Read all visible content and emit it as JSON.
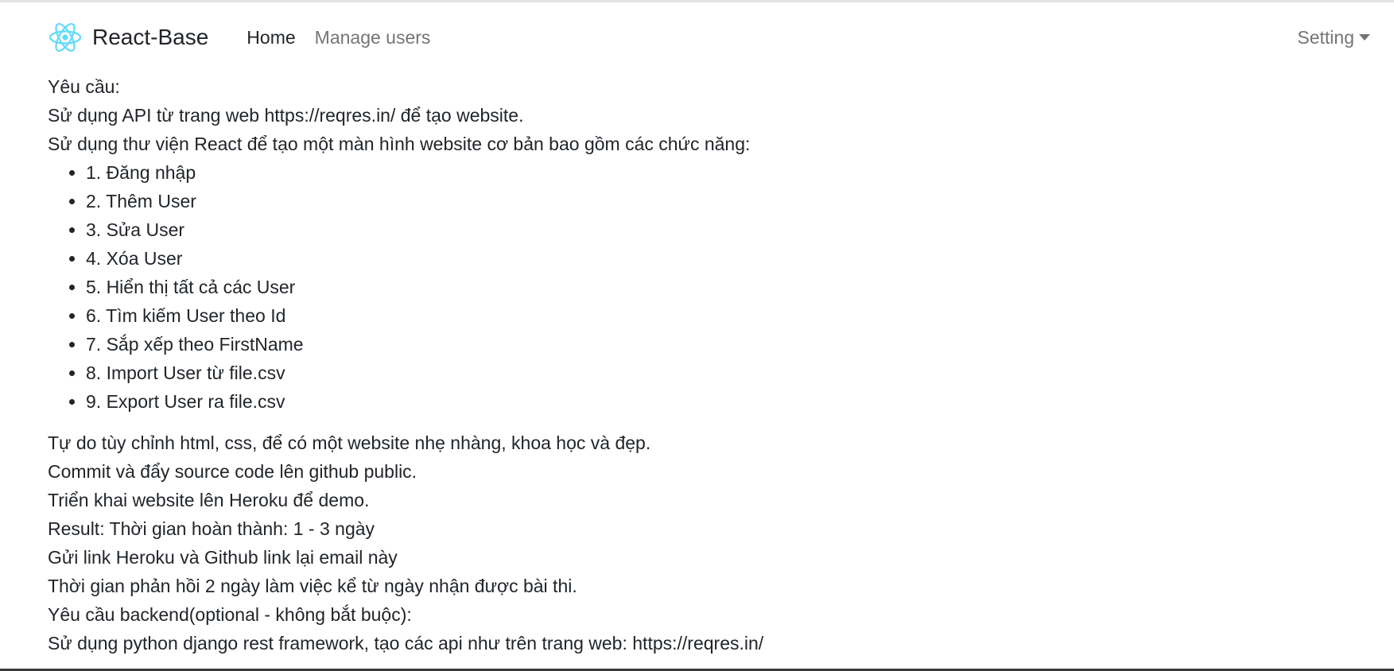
{
  "navbar": {
    "brand_text": "React-Base",
    "brand_logo_icon": "react-atom-icon",
    "links": [
      {
        "label": "Home",
        "active": true
      },
      {
        "label": "Manage users",
        "active": false
      }
    ],
    "setting_label": "Setting",
    "setting_icon": "caret-down-icon"
  },
  "content": {
    "intro": [
      "Yêu cầu:",
      "Sử dụng API từ trang web https://reqres.in/ để tạo website.",
      "Sử dụng thư viện React để tạo một màn hình website cơ bản bao gồm các chức năng:"
    ],
    "features": [
      "1. Đăng nhập",
      "2. Thêm User",
      "3. Sửa User",
      "4. Xóa User",
      "5. Hiển thị tất cả các User",
      "6. Tìm kiếm User theo Id",
      "7. Sắp xếp theo FirstName",
      "8. Import User từ file.csv",
      "9. Export User ra file.csv"
    ],
    "outro": [
      "Tự do tùy chỉnh html, css, để có một website nhẹ nhàng, khoa học và đẹp.",
      "Commit và đẩy source code lên github public.",
      "Triển khai website lên Heroku để demo.",
      "Result: Thời gian hoàn thành: 1 - 3 ngày",
      "Gửi link Heroku và Github link lại email này",
      "Thời gian phản hồi 2 ngày làm việc kể từ ngày nhận được bài thi.",
      "Yêu cầu backend(optional - không bắt buộc):",
      "Sử dụng python django rest framework, tạo các api như trên trang web: https://reqres.in/"
    ]
  },
  "colors": {
    "react_logo": "#61dafb",
    "nav_active": "#212529",
    "nav_muted": "#7f7f7f"
  }
}
